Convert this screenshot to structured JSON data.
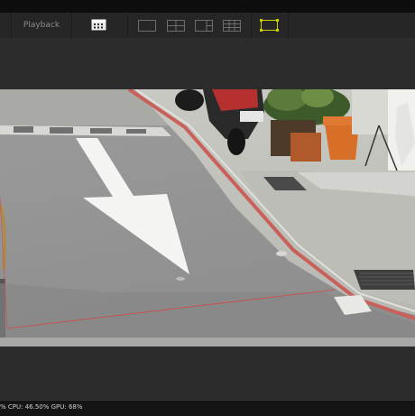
{
  "toolbar": {
    "playback_label": "Playback",
    "icons": [
      "calendar-grid-icon",
      "layout-single-icon",
      "layout-quad-icon",
      "layout-1plus-icon",
      "layout-grid-icon",
      "fullscreen-icon"
    ],
    "accent_color": "#c8d000"
  },
  "status": {
    "text": "% CPU: 46.50% GPU:  68%"
  }
}
